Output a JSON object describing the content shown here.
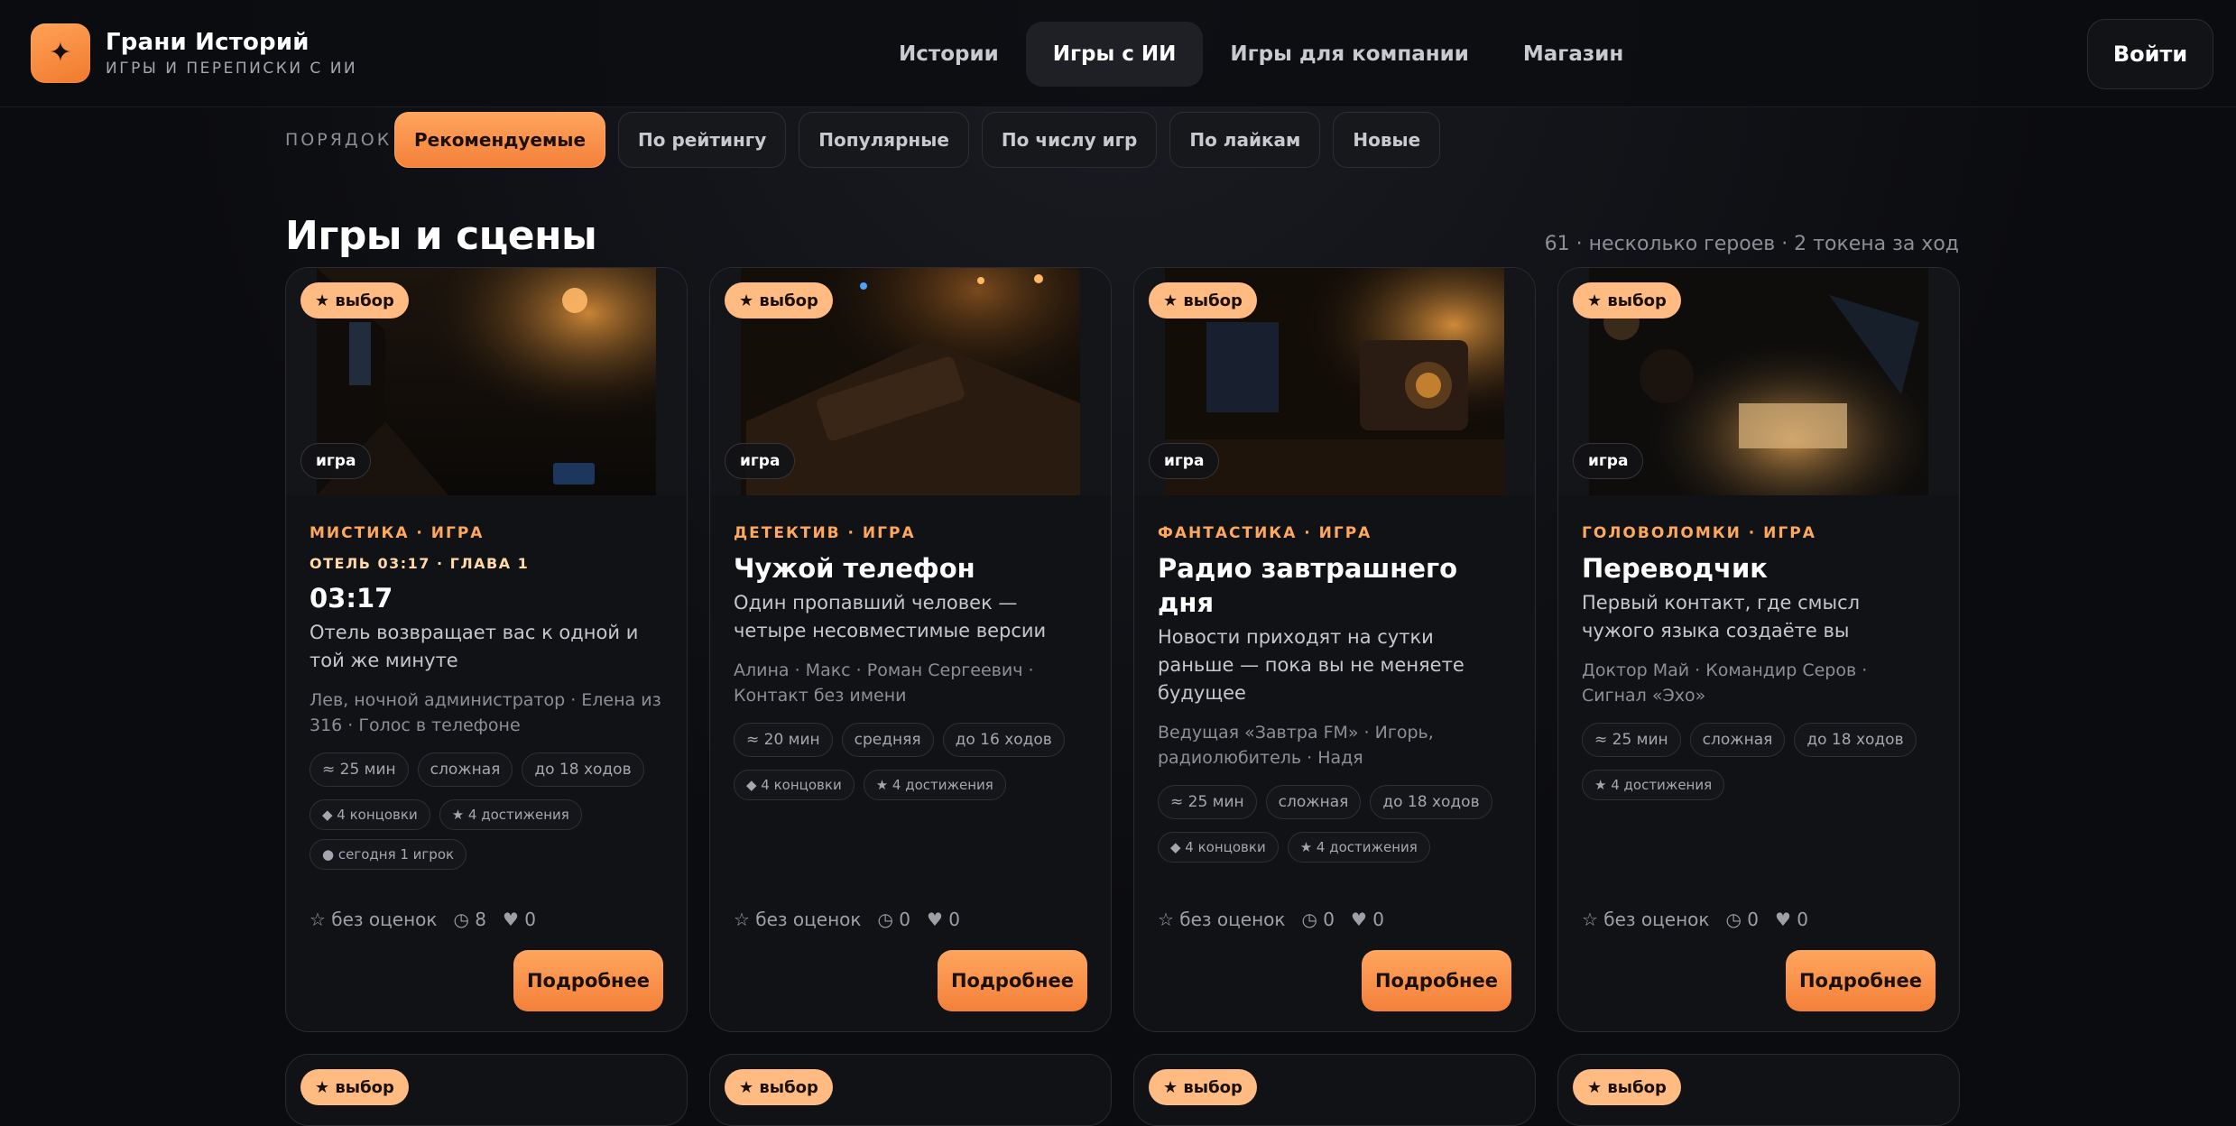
{
  "brand": {
    "name": "Грани Историй",
    "tagline": "ИГРЫ И ПЕРЕПИСКИ С ИИ",
    "logo_icon": "sparkle-icon",
    "accent": "#f4813a"
  },
  "nav": {
    "items": [
      {
        "label": "Истории",
        "active": false
      },
      {
        "label": "Игры с ИИ",
        "active": true
      },
      {
        "label": "Игры для компании",
        "active": false
      },
      {
        "label": "Магазин",
        "active": false
      }
    ],
    "login": "Войти"
  },
  "sort": {
    "label": "ПОРЯДОК",
    "options": [
      {
        "label": "Рекомендуемые",
        "active": true
      },
      {
        "label": "По рейтингу",
        "active": false
      },
      {
        "label": "Популярные",
        "active": false
      },
      {
        "label": "По числу игр",
        "active": false
      },
      {
        "label": "По лайкам",
        "active": false
      },
      {
        "label": "Новые",
        "active": false
      }
    ]
  },
  "section": {
    "title": "Игры и сцены",
    "meta": "61 · несколько героев · 2 токена за ход"
  },
  "cards": [
    {
      "pick": "★ выбор",
      "type": "игра",
      "genre": "МИСТИКА · ИГРА",
      "chapter": "ОТЕЛЬ 03:17 · ГЛАВА 1",
      "title": "03:17",
      "desc": "Отель возвращает вас к одной и той же минуте",
      "cast": "Лев, ночной администратор · Елена из 316 · Голос в телефоне",
      "tags": [
        "≈ 25 мин",
        "сложная",
        "до 18 ходов"
      ],
      "extras": [
        "◆ 4 концовки",
        "★ 4 достижения"
      ],
      "activity": "● сегодня 1 игрок",
      "rating": "☆ без оценок",
      "plays": "◷ 8",
      "likes": "♥ 0",
      "button": "Подробнее"
    },
    {
      "pick": "★ выбор",
      "type": "игра",
      "genre": "ДЕТЕКТИВ · ИГРА",
      "chapter": "",
      "title": "Чужой телефон",
      "desc": "Один пропавший человек — четыре несовместимые версии",
      "cast": "Алина · Макс · Роман Сергеевич · Контакт без имени",
      "tags": [
        "≈ 20 мин",
        "средняя",
        "до 16 ходов"
      ],
      "extras": [
        "◆ 4 концовки",
        "★ 4 достижения"
      ],
      "activity": "",
      "rating": "☆ без оценок",
      "plays": "◷ 0",
      "likes": "♥ 0",
      "button": "Подробнее"
    },
    {
      "pick": "★ выбор",
      "type": "игра",
      "genre": "ФАНТАСТИКА · ИГРА",
      "chapter": "",
      "title": "Радио завтрашнего дня",
      "desc": "Новости приходят на сутки раньше — пока вы не меняете будущее",
      "cast": "Ведущая «Завтра FM» · Игорь, радиолюбитель · Надя",
      "tags": [
        "≈ 25 мин",
        "сложная",
        "до 18 ходов"
      ],
      "extras": [
        "◆ 4 концовки",
        "★ 4 достижения"
      ],
      "activity": "",
      "rating": "☆ без оценок",
      "plays": "◷ 0",
      "likes": "♥ 0",
      "button": "Подробнее"
    },
    {
      "pick": "★ выбор",
      "type": "игра",
      "genre": "ГОЛОВОЛОМКИ · ИГРА",
      "chapter": "",
      "title": "Переводчик",
      "desc": "Первый контакт, где смысл чужого языка создаёте вы",
      "cast": "Доктор Май · Командир Серов · Сигнал «Эхо»",
      "tags": [
        "≈ 25 мин",
        "сложная",
        "до 18 ходов"
      ],
      "extras": [
        "★ 4 достижения"
      ],
      "activity": "",
      "rating": "☆ без оценок",
      "plays": "◷ 0",
      "likes": "♥ 0",
      "button": "Подробнее"
    }
  ],
  "row2_pick": "★ выбор"
}
